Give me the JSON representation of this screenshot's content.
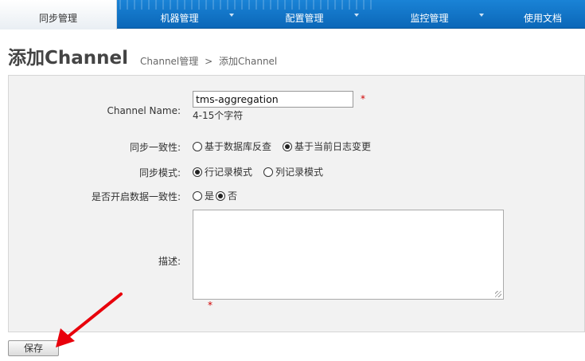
{
  "nav": {
    "items": [
      {
        "label": "同步管理",
        "active": true,
        "has_dropdown": false
      },
      {
        "label": "机器管理",
        "active": false,
        "has_dropdown": true
      },
      {
        "label": "配置管理",
        "active": false,
        "has_dropdown": true
      },
      {
        "label": "监控管理",
        "active": false,
        "has_dropdown": true
      },
      {
        "label": "使用文档",
        "active": false,
        "has_dropdown": false
      }
    ]
  },
  "header": {
    "title": "添加Channel",
    "breadcrumb": [
      "Channel管理",
      ">",
      "添加Channel"
    ]
  },
  "form": {
    "channel_name": {
      "label": "Channel Name:",
      "value": "tms-aggregation",
      "required_mark": "*",
      "hint": "4-15个字符"
    },
    "consistency": {
      "label": "同步一致性:",
      "options": [
        {
          "label": "基于数据库反查",
          "checked": false
        },
        {
          "label": "基于当前日志变更",
          "checked": true
        }
      ]
    },
    "sync_mode": {
      "label": "同步模式:",
      "options": [
        {
          "label": "行记录模式",
          "checked": true
        },
        {
          "label": "列记录模式",
          "checked": false
        }
      ]
    },
    "data_consistency": {
      "label": "是否开启数据一致性:",
      "options": [
        {
          "label": "是",
          "checked": false
        },
        {
          "label": "否",
          "checked": true
        }
      ]
    },
    "description": {
      "label": "描述:",
      "value": "",
      "required_mark": "*"
    }
  },
  "actions": {
    "save_label": "保存"
  },
  "colors": {
    "nav_blue": "#0b67b8",
    "required_red": "#d00000",
    "annotation_arrow_red": "#e8000b"
  }
}
